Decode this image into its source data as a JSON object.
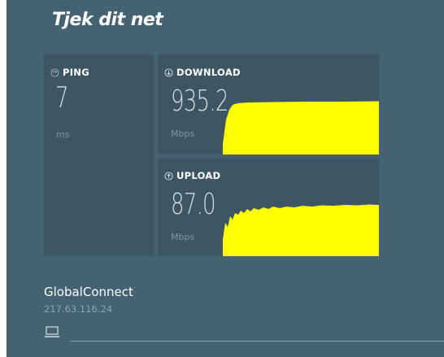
{
  "brand": {
    "title": "Tjek dit net"
  },
  "ping": {
    "label": "PING",
    "value": "7",
    "unit": "ms",
    "icon": "ping-icon"
  },
  "download": {
    "label": "DOWNLOAD",
    "value": "935.2",
    "unit": "Mbps",
    "icon": "download-arrow-icon",
    "fill_color": "#ffff00"
  },
  "upload": {
    "label": "UPLOAD",
    "value": "87.0",
    "unit": "Mbps",
    "icon": "upload-arrow-icon",
    "fill_color": "#ffff00"
  },
  "connection": {
    "isp": "GlobalConnect",
    "ip": "217.63.116.24",
    "device_icon": "laptop-icon"
  },
  "colors": {
    "background": "#456273",
    "panel": "#3e5563",
    "graph": "#ffff00"
  }
}
